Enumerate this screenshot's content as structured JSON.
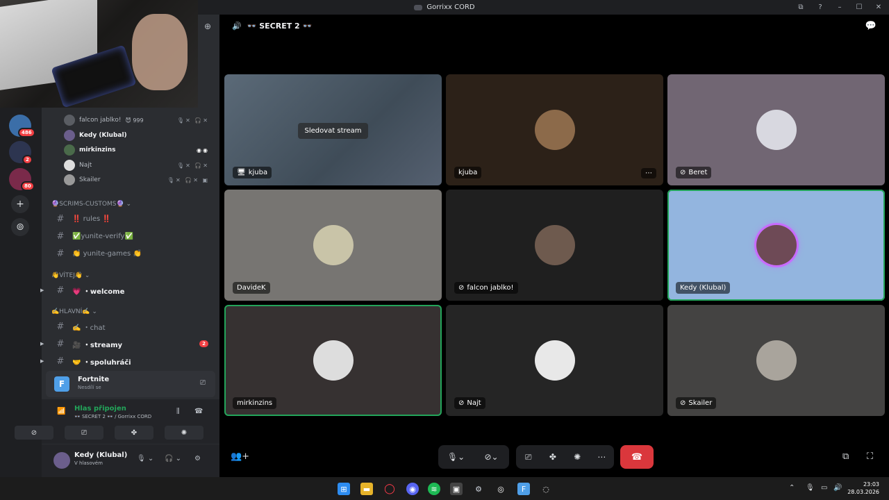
{
  "window": {
    "title": "Gorrixx CORD",
    "controls": [
      "⧉",
      "?",
      "–",
      "☐",
      "✕"
    ]
  },
  "rail": {
    "badges": [
      "486",
      "2",
      "80"
    ],
    "add_icon": "+",
    "explore_icon": "⊚"
  },
  "members": [
    {
      "name": "falcon jablko!",
      "tag": "😈 999",
      "icons": "🎙✕ 🎧✕"
    },
    {
      "name": "Kedy (Klubal)",
      "tag": "",
      "icons": ""
    },
    {
      "name": "mirkinzins",
      "tag": "",
      "icons": "◉◉"
    },
    {
      "name": "Najt",
      "tag": "",
      "icons": "🎙✕ 🎧✕"
    },
    {
      "name": "Skailer",
      "tag": "",
      "icons": "🎙✕ 🎧✕ ▣"
    }
  ],
  "categories": {
    "scrims": "🔮SCRIMS-CUSTOMS🔮",
    "vitej": "👋VÍTEJ👋",
    "hlavni": "✍️HLAVNÍ✍️"
  },
  "channels": {
    "rules": "‼️ rules ‼️",
    "verify": "✅yunite-verify✅",
    "games": "👏 yunite-games 👏",
    "welcome": "💗 ・welcome",
    "chat": "✍️ ・chat",
    "streamy": "🎥 ・streamy",
    "streamy_count": "2",
    "spoluhraci": "🤝 ・spoluhráči"
  },
  "activity": {
    "game": "Fortnite",
    "status": "Nesdílí se",
    "icon_letter": "F"
  },
  "voice": {
    "status": "Hlas připojen",
    "location": "👓 SECRET 2 👓 / Gorrixx CORD"
  },
  "user": {
    "name": "Kedy (Klubal)",
    "status": "V hlasovém"
  },
  "stage": {
    "channel": "👓 SECRET 2 👓",
    "watch_label": "Sledovat stream",
    "tiles": [
      {
        "name": "kjuba",
        "icon": "🖥",
        "bg": "#4a5866"
      },
      {
        "name": "kjuba",
        "icon": "",
        "bg": "#2c2118"
      },
      {
        "name": "Beret",
        "icon": "⊘",
        "bg": "#716673"
      },
      {
        "name": "DavideK",
        "icon": "",
        "bg": "#777572"
      },
      {
        "name": "falcon jablko!",
        "icon": "⊘",
        "bg": "#1f1f1f"
      },
      {
        "name": "Kedy (Klubal)",
        "icon": "",
        "bg": "#93b5df"
      },
      {
        "name": "mirkinzins",
        "icon": "",
        "bg": "#363131"
      },
      {
        "name": "Najt",
        "icon": "⊘",
        "bg": "#252525"
      },
      {
        "name": "Skailer",
        "icon": "⊘",
        "bg": "#444342"
      }
    ],
    "more": "⋯"
  },
  "taskbar": {
    "time": "23:03",
    "date": "28.03.2026"
  }
}
